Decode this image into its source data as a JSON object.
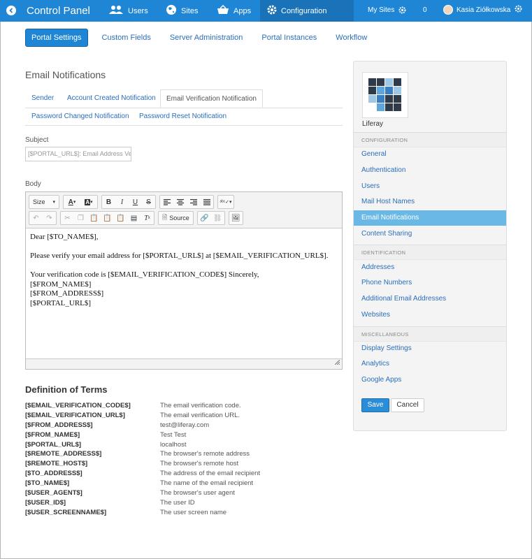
{
  "topbar": {
    "title": "Control Panel",
    "nav": [
      {
        "label": "Users",
        "icon": "users-icon"
      },
      {
        "label": "Sites",
        "icon": "globe-icon"
      },
      {
        "label": "Apps",
        "icon": "basket-icon"
      },
      {
        "label": "Configuration",
        "icon": "gear-icon"
      }
    ],
    "my_sites": "My Sites",
    "notification_count": "0",
    "user_name": "Kasia Ziółkowska",
    "accent": "#1f86d6"
  },
  "subnav": [
    "Portal Settings",
    "Custom Fields",
    "Server Administration",
    "Portal Instances",
    "Workflow"
  ],
  "main": {
    "title": "Email Notifications",
    "tabs_row1": [
      "Sender",
      "Account Created Notification",
      "Email Verification Notification"
    ],
    "tabs_row2": [
      "Password Changed Notification",
      "Password Reset Notification"
    ],
    "subject_label": "Subject",
    "subject_value": "[$PORTAL_URL$]: Email Address Verification",
    "body_label": "Body",
    "toolbar": {
      "size_label": "Size",
      "source_label": "Source"
    },
    "body_lines": [
      "Dear [$TO_NAME$],",
      "",
      "Please verify your email address for [$PORTAL_URL$] at [$EMAIL_VERIFICATION_URL$].",
      "",
      "Your verification code is [$EMAIL_VERIFICATION_CODE$] Sincerely,",
      "[$FROM_NAME$]",
      "[$FROM_ADDRESS$]",
      "[$PORTAL_URL$]"
    ]
  },
  "definitions": {
    "title": "Definition of Terms",
    "rows": [
      {
        "term": "[$EMAIL_VERIFICATION_CODE$]",
        "desc": "The email verification code."
      },
      {
        "term": "[$EMAIL_VERIFICATION_URL$]",
        "desc": "The email verification URL."
      },
      {
        "term": "[$FROM_ADDRESS$]",
        "desc": "test@liferay.com"
      },
      {
        "term": "[$FROM_NAME$]",
        "desc": "Test Test"
      },
      {
        "term": "[$PORTAL_URL$]",
        "desc": "localhost"
      },
      {
        "term": "[$REMOTE_ADDRESS$]",
        "desc": "The browser's remote address"
      },
      {
        "term": "[$REMOTE_HOST$]",
        "desc": "The browser's remote host"
      },
      {
        "term": "[$TO_ADDRESS$]",
        "desc": "The address of the email recipient"
      },
      {
        "term": "[$TO_NAME$]",
        "desc": "The name of the email recipient"
      },
      {
        "term": "[$USER_AGENT$]",
        "desc": "The browser's user agent"
      },
      {
        "term": "[$USER_ID$]",
        "desc": "The user ID"
      },
      {
        "term": "[$USER_SCREENNAME$]",
        "desc": "The user screen name"
      }
    ]
  },
  "sidebar": {
    "logo_name": "Liferay",
    "sections": [
      {
        "heading": "CONFIGURATION",
        "items": [
          "General",
          "Authentication",
          "Users",
          "Mail Host Names",
          "Email Notifications",
          "Content Sharing"
        ]
      },
      {
        "heading": "IDENTIFICATION",
        "items": [
          "Addresses",
          "Phone Numbers",
          "Additional Email Addresses",
          "Websites"
        ]
      },
      {
        "heading": "MISCELLANEOUS",
        "items": [
          "Display Settings",
          "Analytics",
          "Google Apps"
        ]
      }
    ],
    "active_item": "Email Notifications",
    "save_label": "Save",
    "cancel_label": "Cancel"
  }
}
